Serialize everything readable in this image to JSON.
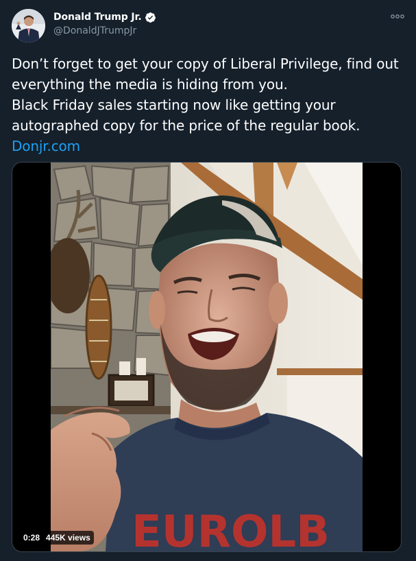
{
  "author": {
    "display_name": "Donald Trump Jr.",
    "handle": "@DonaldJTrumpJr",
    "verified": true,
    "avatar_icon": "profile-photo"
  },
  "tweet": {
    "lines": [
      "Don’t forget to get your copy of Liberal Privilege, find out everything the media is hiding from you.",
      "Black Friday sales starting now like getting your autographed copy for the price of the regular book."
    ],
    "link_text": "Donjr.com"
  },
  "video": {
    "duration": "0:28",
    "views": "445K views",
    "shirt_text": "EUROLB"
  },
  "colors": {
    "background": "#15202b",
    "text": "#ffffff",
    "secondary_text": "#8899a6",
    "link": "#1da1f2",
    "verified_badge": "#ffffff",
    "media_border": "#38444d"
  },
  "icons": {
    "more": "more-dots-icon",
    "verified": "verified-check-icon"
  }
}
